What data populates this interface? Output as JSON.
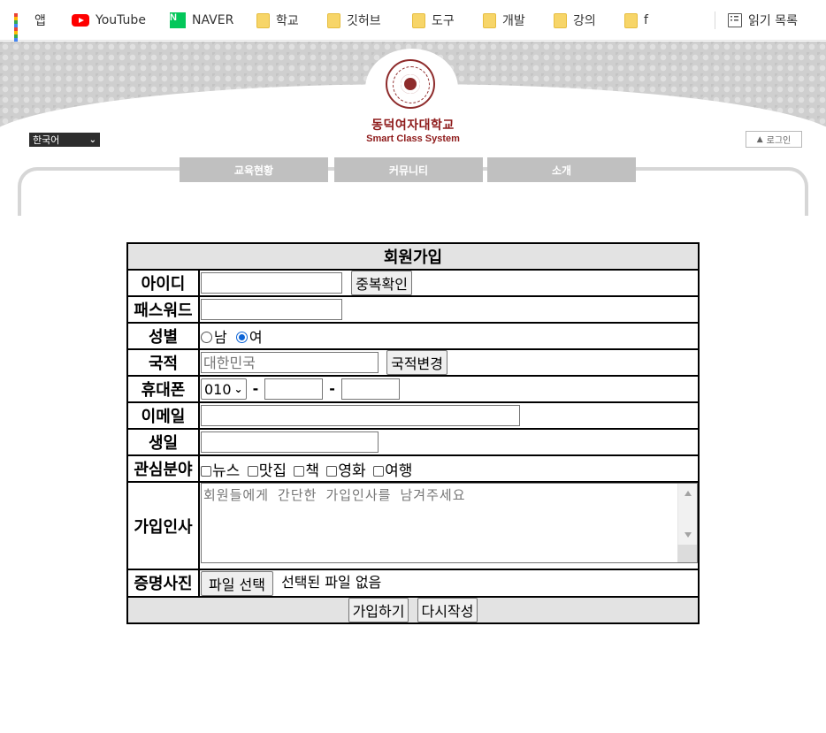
{
  "bookmarks": {
    "items": [
      {
        "label": "앱",
        "icon": "apps-grid-icon"
      },
      {
        "label": "YouTube",
        "icon": "youtube-icon"
      },
      {
        "label": "NAVER",
        "icon": "naver-icon",
        "icon_letter": "N"
      },
      {
        "label": "학교",
        "icon": "folder-icon"
      },
      {
        "label": "깃허브",
        "icon": "folder-icon"
      },
      {
        "label": "도구",
        "icon": "folder-icon"
      },
      {
        "label": "개발",
        "icon": "folder-icon"
      },
      {
        "label": "강의",
        "icon": "folder-icon"
      },
      {
        "label": "f",
        "icon": "folder-icon"
      }
    ],
    "reading_list": "읽기 목록"
  },
  "header": {
    "univ_name": "동덕여자대학교",
    "subtitle": "Smart Class System",
    "language": "한국어",
    "login": "로그인",
    "nav": [
      "교육현황",
      "커뮤니티",
      "소개"
    ],
    "brand_color": "#8e1a1a"
  },
  "form": {
    "title": "회원가입",
    "labels": {
      "id": "아이디",
      "password": "패스워드",
      "gender": "성별",
      "nationality": "국적",
      "phone": "휴대폰",
      "email": "이메일",
      "birthday": "생일",
      "interests": "관심분야",
      "greeting": "가입인사",
      "photo": "증명사진"
    },
    "id_value": "",
    "duplicate_check": "중복확인",
    "password_value": "",
    "gender_options": [
      "남",
      "여"
    ],
    "gender_selected": "여",
    "nationality_placeholder": "대한민국",
    "change_nationality": "국적변경",
    "phone_prefix": "010",
    "phone_middle": "",
    "phone_last": "",
    "phone_separator": "-",
    "email_value": "",
    "birthday_value": "",
    "interests_options": [
      "뉴스",
      "맛집",
      "책",
      "영화",
      "여행"
    ],
    "greeting_placeholder": "회원들에게 간단한 가입인사를 남겨주세요",
    "file_button": "파일 선택",
    "file_status": "선택된 파일 없음",
    "submit": "가입하기",
    "reset": "다시작성"
  }
}
